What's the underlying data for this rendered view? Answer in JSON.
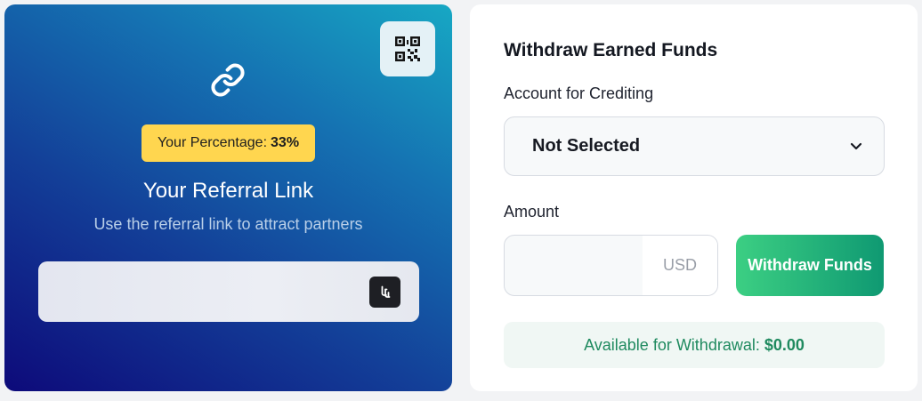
{
  "referral": {
    "qr_icon": "qr-code-icon",
    "link_icon": "chain-link-icon",
    "percentage_label": "Your Percentage:",
    "percentage_value": "33%",
    "title": "Your Referral Link",
    "subtitle": "Use the referral link to attract partners",
    "link_value": "",
    "copy_icon": "copy-icon"
  },
  "withdraw": {
    "title": "Withdraw Earned Funds",
    "account_label": "Account for Crediting",
    "account_selected": "Not Selected",
    "amount_label": "Amount",
    "amount_value": "",
    "currency": "USD",
    "button_label": "Withdraw Funds",
    "available_label": "Available for Withdrawal:",
    "available_value": "$0.00"
  },
  "colors": {
    "badge": "#ffd64f",
    "accent_green": "#3ccf83",
    "available_text": "#1f8a5f"
  }
}
